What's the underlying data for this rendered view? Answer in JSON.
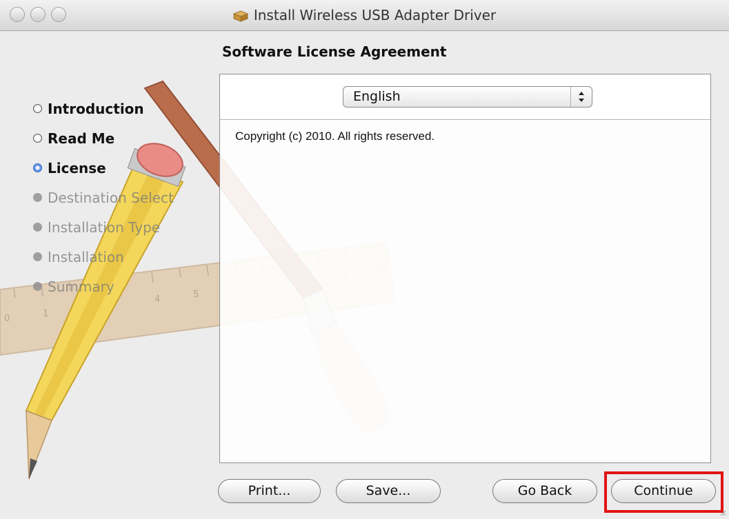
{
  "window": {
    "title": "Install Wireless USB Adapter Driver"
  },
  "icons": {
    "title": "package-icon",
    "traffic": [
      "close-button",
      "minimize-button",
      "zoom-button"
    ],
    "select": "up-down-arrows-icon",
    "background": "pencil-brush-ruler-artwork"
  },
  "heading": "Software License Agreement",
  "steps": [
    {
      "label": "Introduction",
      "state": "done"
    },
    {
      "label": "Read Me",
      "state": "done"
    },
    {
      "label": "License",
      "state": "current"
    },
    {
      "label": "Destination Select",
      "state": "future"
    },
    {
      "label": "Installation Type",
      "state": "future"
    },
    {
      "label": "Installation",
      "state": "future"
    },
    {
      "label": "Summary",
      "state": "future"
    }
  ],
  "language": {
    "selected": "English"
  },
  "license": {
    "text": "Copyright (c) 2010.  All rights reserved."
  },
  "buttons": {
    "print": "Print...",
    "save": "Save...",
    "go_back": "Go Back",
    "continue": "Continue"
  },
  "colors": {
    "highlight": "#e01414",
    "current_step": "#2b63c4"
  }
}
